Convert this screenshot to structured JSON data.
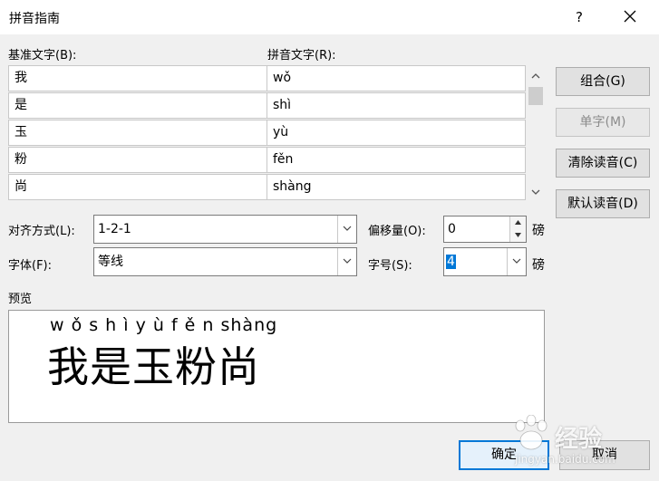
{
  "window": {
    "title": "拼音指南",
    "help_label": "?"
  },
  "columns": {
    "base_label": "基准文字(B):",
    "pinyin_label": "拼音文字(R):"
  },
  "rows": [
    {
      "base": "我",
      "pinyin": "wǒ"
    },
    {
      "base": "是",
      "pinyin": "shì"
    },
    {
      "base": "玉",
      "pinyin": "yù"
    },
    {
      "base": "粉",
      "pinyin": "fěn"
    },
    {
      "base": "尚",
      "pinyin": "shàng"
    }
  ],
  "buttons": {
    "combine": "组合(G)",
    "single": "单字(M)",
    "clear": "清除读音(C)",
    "default": "默认读音(D)",
    "ok": "确定",
    "cancel": "取消"
  },
  "options": {
    "align_label": "对齐方式(L):",
    "align_value": "1-2-1",
    "offset_label": "偏移量(O):",
    "offset_value": "0",
    "offset_unit": "磅",
    "font_label": "字体(F):",
    "font_value": "等线",
    "size_label": "字号(S):",
    "size_value": "4",
    "size_unit": "磅"
  },
  "preview": {
    "label": "预览",
    "ruby_text": "w ǒ s h ì y ù f ě n shàng",
    "base_text": "我是玉粉尚"
  },
  "watermark": {
    "text": "经验",
    "sub": "jingyan.baidu.com"
  }
}
